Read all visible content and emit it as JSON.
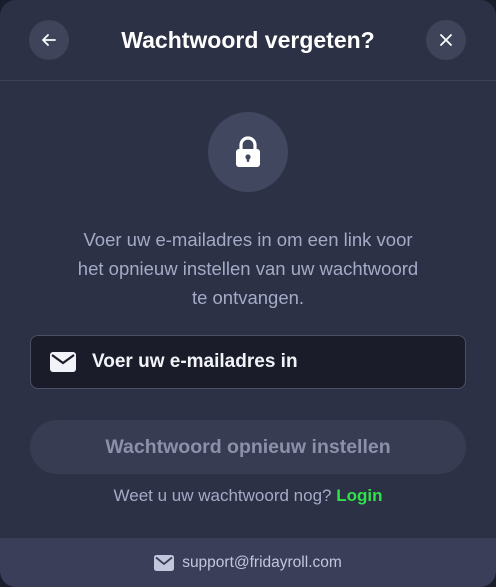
{
  "header": {
    "title": "Wachtwoord vergeten?",
    "back_icon": "arrow-left-icon",
    "close_icon": "close-icon"
  },
  "lock_icon": "lock-icon",
  "description": {
    "line1": "Voer uw e-mailadres in om een link voor",
    "line2": "het opnieuw instellen van uw wachtwoord",
    "line3": "te ontvangen."
  },
  "email_field": {
    "icon": "envelope-icon",
    "placeholder": "Voer uw e-mailadres in",
    "value": ""
  },
  "reset_button": {
    "label": "Wachtwoord opnieuw instellen"
  },
  "login_prompt": {
    "text": "Weet u uw wachtwoord nog?",
    "link_label": "Login"
  },
  "footer": {
    "icon": "envelope-icon",
    "support_email": "support@fridayroll.com"
  },
  "colors": {
    "background": "#2d3146",
    "accent_green": "#2ee24a",
    "input_bg": "#1a1c29",
    "button_disabled_bg": "#383c52",
    "footer_bg": "#3a3e58"
  }
}
